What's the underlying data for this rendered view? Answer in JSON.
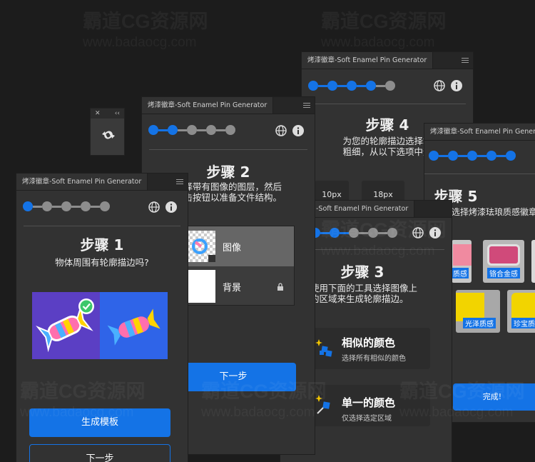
{
  "watermark": {
    "text": "霸道CG资源网",
    "url": "www.badaocg.com"
  },
  "common": {
    "tab_title": "烤漆徽章-Soft Enamel Pin Generator",
    "tab_title_cut": "-Soft Enamel Pin Generator"
  },
  "panel_small": {
    "a": "✕",
    "b": "‹‹"
  },
  "step1": {
    "title": "步骤 1",
    "desc": "物体周围有轮廓描边吗?",
    "btn_template": "生成模板",
    "btn_next": "下一步"
  },
  "step2": {
    "title": "步骤 2",
    "desc_line1": "选择带有图像的图层，然后",
    "desc_line2": "点击按钮以准备文件结构。",
    "layer_image": "图像",
    "layer_bg": "背景",
    "btn_next": "下一步"
  },
  "step3": {
    "title": "步骤 3",
    "desc_line1": "使用下面的工具选择图像上",
    "desc_line2": "的区域来生成轮廓描边。",
    "tool1_title": "相似的颜色",
    "tool1_sub": "选择所有相似的颜色",
    "tool2_title": "单一的颜色",
    "tool2_sub": "仅选择选定区域"
  },
  "step4": {
    "title": "步骤 4",
    "desc_line1": "为您的轮廓描边选择笔",
    "desc_line2": "粗细，从以下选项中选",
    "opt1": "10px",
    "opt2": "18px"
  },
  "step5": {
    "title": "步骤 5",
    "desc": "选择烤漆珐琅质感徽章",
    "t1": "质感",
    "t2": "铬合金感",
    "t3": "光泽质感",
    "t4": "珍宝质感",
    "btn_done": "完成!"
  },
  "colors": {
    "accent": "#1473e6",
    "panel": "#323232",
    "bg": "#1c1c1c"
  }
}
